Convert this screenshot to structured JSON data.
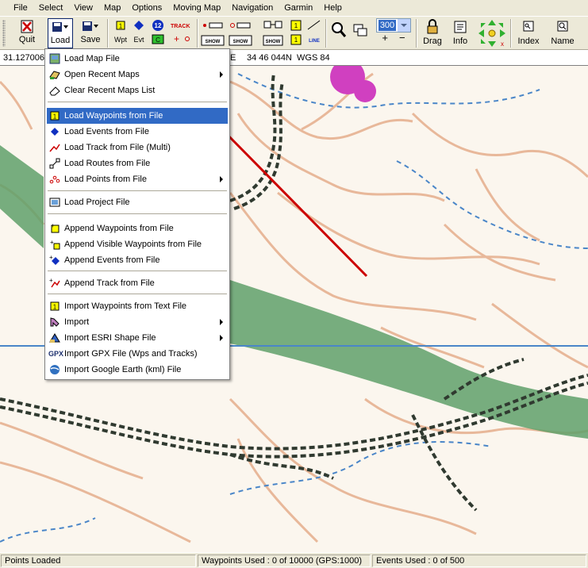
{
  "menubar": {
    "items": [
      "File",
      "Select",
      "View",
      "Map",
      "Options",
      "Moving Map",
      "Navigation",
      "Garmin",
      "Help"
    ]
  },
  "toolbar": {
    "quit_label": "Quit",
    "load_label": "Load",
    "save_label": "Save",
    "wpt_label": "Wpt",
    "evt_label": "Evt",
    "event_badge": "12",
    "track_label": "TRACK",
    "show_label": "SHOW",
    "line_label": "LINE",
    "zoom_value": "300",
    "drag_label": "Drag",
    "info_label": "Info",
    "index_label": "Index",
    "name_label": "Name"
  },
  "coordbar": {
    "lon": "31.127006",
    "lat_suffix": "E",
    "lat": "34 46 044N",
    "datum": "WGS 84"
  },
  "file_menu": {
    "items": [
      {
        "label": "Load Map File",
        "icon": "map-file-icon",
        "submenu": false
      },
      {
        "label": "Open Recent Maps",
        "icon": "recent-maps-icon",
        "submenu": true
      },
      {
        "label": "Clear Recent Maps List",
        "icon": "eraser-icon",
        "submenu": false
      },
      {
        "label": "Load Waypoints from File",
        "icon": "waypoint-icon",
        "submenu": false,
        "highlighted": true
      },
      {
        "label": "Load Events from File",
        "icon": "event-diamond-icon",
        "submenu": false
      },
      {
        "label": "Load Track from File (Multi)",
        "icon": "track-icon",
        "submenu": false
      },
      {
        "label": "Load Routes from File",
        "icon": "route-icon",
        "submenu": false
      },
      {
        "label": "Load Points from File",
        "icon": "points-icon",
        "submenu": true
      },
      {
        "label": "Load Project File",
        "icon": "project-icon",
        "submenu": false
      },
      {
        "label": "Append Waypoints from File",
        "icon": "append-waypoint-icon",
        "submenu": false
      },
      {
        "label": "Append Visible Waypoints from File",
        "icon": "append-visible-icon",
        "submenu": false
      },
      {
        "label": "Append Events from File",
        "icon": "append-event-icon",
        "submenu": false
      },
      {
        "label": "Append Track from File",
        "icon": "append-track-icon",
        "submenu": false
      },
      {
        "label": "Import Waypoints from Text File",
        "icon": "import-text-icon",
        "submenu": false
      },
      {
        "label": "Import",
        "icon": "import-icon",
        "submenu": true
      },
      {
        "label": "Import ESRI Shape File",
        "icon": "esri-icon",
        "submenu": true
      },
      {
        "label": "Import GPX File (Wps and Tracks)",
        "icon": "gpx-icon",
        "submenu": false
      },
      {
        "label": "Import Google Earth (kml) File",
        "icon": "google-earth-icon",
        "submenu": false
      }
    ],
    "gpx_icon_text": "GPX"
  },
  "status": {
    "message": "Points Loaded",
    "waypoints": "Waypoints Used : 0 of 10000  (GPS:1000)",
    "events": "Events Used : 0 of 500"
  },
  "colors": {
    "highlight": "#316ac5",
    "arrow": "#cc0000",
    "contour": "#e8b89a",
    "vegetation": "#5fa06a",
    "water": "#4a86c8",
    "road": "#303a30",
    "magenta": "#d040c0"
  }
}
